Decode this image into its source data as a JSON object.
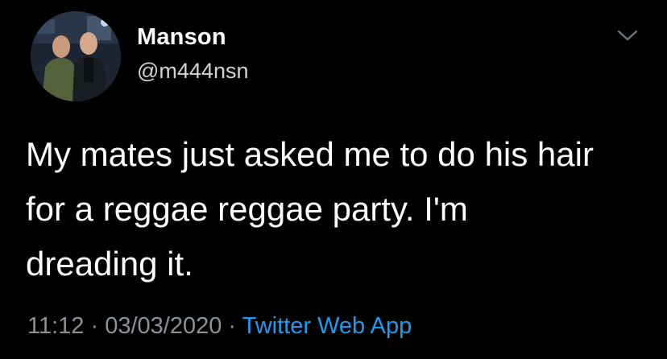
{
  "user": {
    "display_name": "Manson",
    "handle": "@m444nsn",
    "avatar_icon": "profile-photo"
  },
  "tweet": {
    "text": "My mates just asked me to do his hair\nfor a reggae reggae party. I'm\ndreading it."
  },
  "meta": {
    "time": "11:12",
    "separator_1": " · ",
    "date": "03/03/2020",
    "separator_2": " · ",
    "source": "Twitter Web App"
  },
  "menu": {
    "icon": "chevron-down-icon"
  },
  "colors": {
    "background": "#000000",
    "text": "#ffffff",
    "secondary_text": "#8b9199",
    "link": "#1d9bf0"
  }
}
